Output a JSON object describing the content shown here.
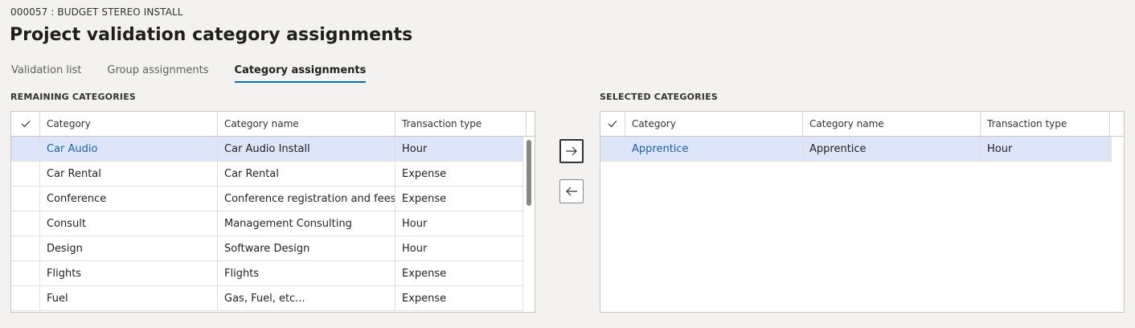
{
  "header": {
    "caption": "000057 : BUDGET STEREO INSTALL",
    "title": "Project validation category assignments"
  },
  "tabs": [
    {
      "label": "Validation list",
      "active": false
    },
    {
      "label": "Group assignments",
      "active": false
    },
    {
      "label": "Category assignments",
      "active": true
    }
  ],
  "remaining": {
    "label": "REMAINING CATEGORIES",
    "columns": [
      "Category",
      "Category name",
      "Transaction type"
    ],
    "rows": [
      {
        "category": "Car Audio",
        "name": "Car Audio Install",
        "type": "Hour",
        "selected": true
      },
      {
        "category": "Car Rental",
        "name": "Car Rental",
        "type": "Expense",
        "selected": false
      },
      {
        "category": "Conference",
        "name": "Conference registration and fees",
        "type": "Expense",
        "selected": false
      },
      {
        "category": "Consult",
        "name": "Management Consulting",
        "type": "Hour",
        "selected": false
      },
      {
        "category": "Design",
        "name": "Software Design",
        "type": "Hour",
        "selected": false
      },
      {
        "category": "Flights",
        "name": "Flights",
        "type": "Expense",
        "selected": false
      },
      {
        "category": "Fuel",
        "name": "Gas, Fuel, etc...",
        "type": "Expense",
        "selected": false
      }
    ]
  },
  "selected": {
    "label": "SELECTED CATEGORIES",
    "columns": [
      "Category",
      "Category name",
      "Transaction type"
    ],
    "rows": [
      {
        "category": "Apprentice",
        "name": "Apprentice",
        "type": "Hour",
        "selected": true
      }
    ]
  },
  "colors": {
    "accent": "#0f6cbd",
    "link": "#205ea8",
    "selected_row": "#dce6f8"
  },
  "icons": {
    "add": "arrow-right-icon",
    "remove": "arrow-left-icon",
    "select_all": "checkmark-icon"
  }
}
